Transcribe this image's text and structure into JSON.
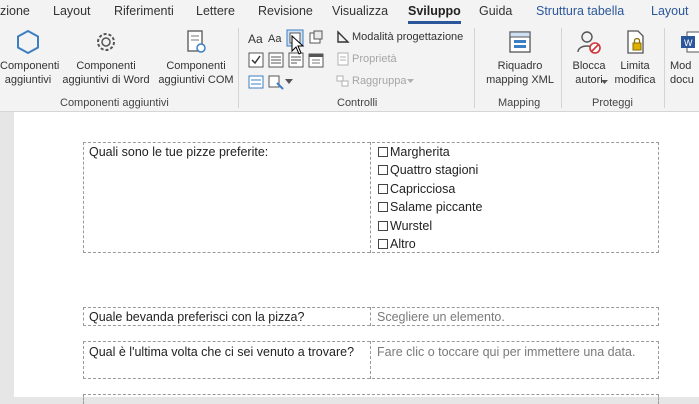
{
  "tabs": [
    "zione",
    "Layout",
    "Riferimenti",
    "Lettere",
    "Revisione",
    "Visualizza",
    "Sviluppo",
    "Guida",
    "Struttura tabella",
    "Layout"
  ],
  "active_tab": "Sviluppo",
  "ribbon": {
    "addins": {
      "btn1": "Componenti\naggiuntivi",
      "btn2": "Componenti\naggiuntivi di Word",
      "btn3": "Componenti\naggiuntivi COM",
      "label": "Componenti aggiuntivi"
    },
    "controls": {
      "text_aa1": "Aa",
      "text_aa2": "Aa",
      "design_mode": "Modalità progettazione",
      "properties": "Proprietà",
      "group": "Raggruppa",
      "label": "Controlli"
    },
    "mapping": {
      "btn": "Riquadro\nmapping XML",
      "label": "Mapping"
    },
    "protect": {
      "btn1": "Blocca\nautori",
      "btn2": "Limita\nmodifica",
      "label": "Proteggi"
    },
    "templates": {
      "btn": "Mod\ndocu"
    }
  },
  "form": {
    "q1": "Quali sono le tue pizze preferite:",
    "pizzas": [
      "Margherita",
      "Quattro stagioni",
      "Capricciosa",
      "Salame piccante",
      "Wurstel",
      "Altro"
    ],
    "q2": "Quale bevanda preferisci con la pizza?",
    "a2": "Scegliere un elemento.",
    "q3": "Qual è l'ultima volta che ci sei venuto a trovare?",
    "a3": "Fare clic o toccare qui per immettere una data."
  },
  "colors": {
    "accent": "#2b579a",
    "ribbon_bg": "#f3f3f3",
    "icon_blue": "#3c7fc2"
  }
}
